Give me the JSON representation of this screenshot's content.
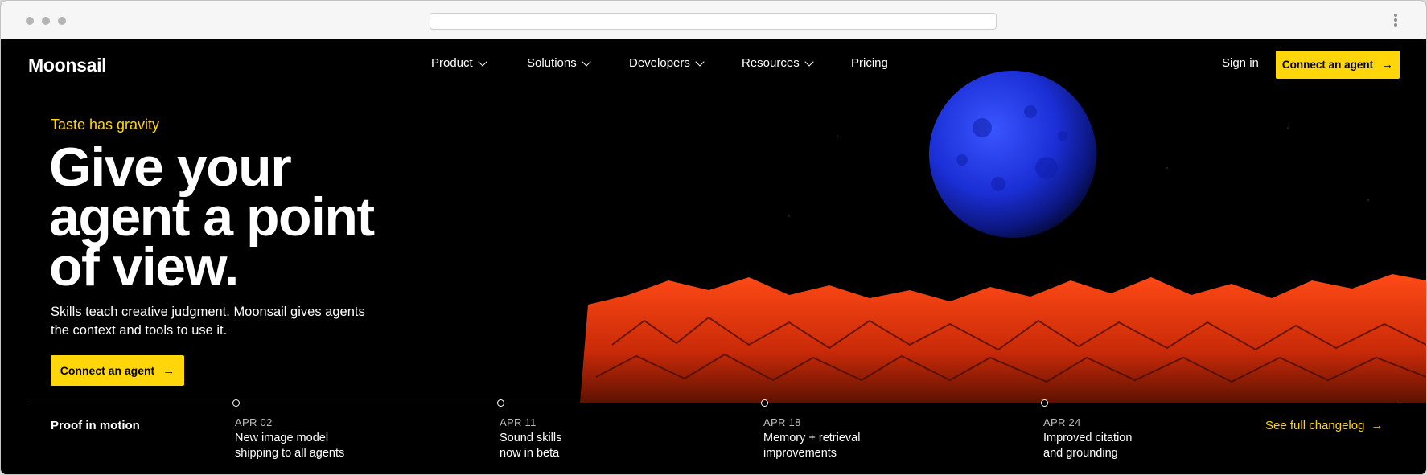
{
  "brand": "Moonsail",
  "nav": {
    "items": [
      {
        "label": "Product",
        "dropdown": true
      },
      {
        "label": "Solutions",
        "dropdown": true
      },
      {
        "label": "Developers",
        "dropdown": true
      },
      {
        "label": "Resources",
        "dropdown": true
      },
      {
        "label": "Pricing",
        "dropdown": false
      }
    ],
    "sign_in": "Sign in",
    "cta": "Connect an agent"
  },
  "hero": {
    "eyebrow": "Taste has gravity",
    "headline_lines": [
      "Give your",
      "agent a point",
      "of view."
    ],
    "subtitle": "Skills teach creative judgment. Moonsail gives agents the context and tools to use it.",
    "cta": "Connect an agent"
  },
  "timeline": {
    "label": "Proof in motion",
    "events": [
      {
        "date": "APR 02",
        "title": "New image model shipping to all agents"
      },
      {
        "date": "APR 11",
        "title": "Sound skills now in beta"
      },
      {
        "date": "APR 18",
        "title": "Memory + retrieval improvements"
      },
      {
        "date": "APR 24",
        "title": "Improved citation and grounding"
      }
    ],
    "changelog": "See full changelog"
  },
  "colors": {
    "accent": "#ffd60a",
    "background": "#000000",
    "planet": "#1b2fd6",
    "terrain": "#e8360f"
  },
  "icons": {
    "arrow": "arrow-right-icon",
    "chevron": "chevron-down-icon",
    "browser_menu": "kebab-menu-icon"
  }
}
